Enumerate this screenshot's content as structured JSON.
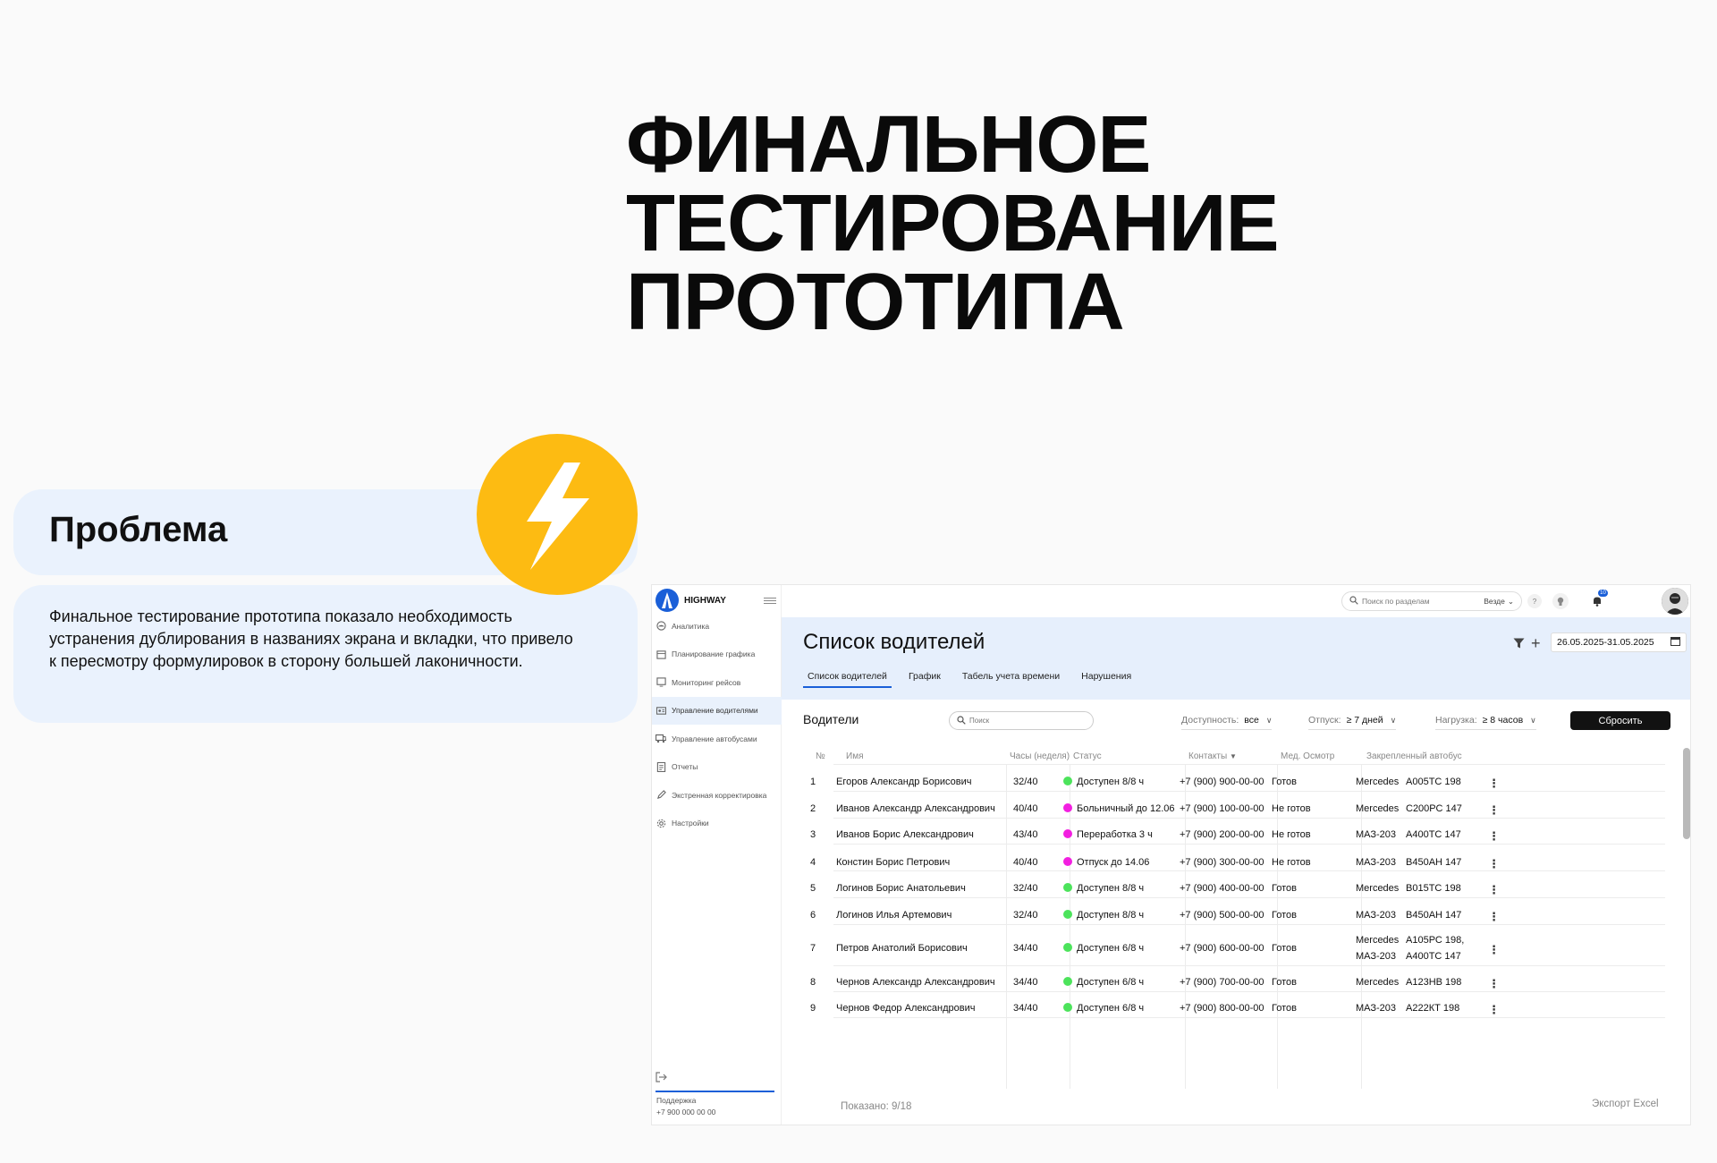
{
  "hero": {
    "lines": [
      "ФИНАЛЬНОЕ",
      "ТЕСТИРОВАНИЕ",
      "ПРОТОТИПА"
    ]
  },
  "problem": {
    "title": "Проблема",
    "lines": [
      "Финальное тестирование прототипа показало необходимость",
      "устранения дублирования в названиях экрана и вкладки, что привело",
      "к пересмотру формулировок в сторону большей лаконичности."
    ],
    "icon": "lightning-bolt-icon",
    "accent": "#FDBB12"
  },
  "app": {
    "brand": "HIGHWAY",
    "nav": [
      {
        "label": "Аналитика",
        "icon": "gauge-icon",
        "active": false
      },
      {
        "label": "Планирование графика",
        "icon": "calendar-icon",
        "active": false
      },
      {
        "label": "Мониторинг рейсов",
        "icon": "monitor-icon",
        "active": false
      },
      {
        "label": "Управление водителями",
        "icon": "id-card-icon",
        "active": true
      },
      {
        "label": "Управление автобусами",
        "icon": "bus-icon",
        "active": false
      },
      {
        "label": "Отчеты",
        "icon": "report-icon",
        "active": false
      },
      {
        "label": "Экстренная корректировка",
        "icon": "pencil-icon",
        "active": false
      },
      {
        "label": "Настройки",
        "icon": "gear-icon",
        "active": false
      }
    ],
    "support": {
      "label": "Поддержка",
      "phone": "+7 900 000 00 00"
    },
    "topbar": {
      "search_placeholder": "Поиск по разделам",
      "search_scope": "Везде",
      "help": "?",
      "notifications": "10"
    },
    "page_title": "Список водителей",
    "date_range": "26.05.2025-31.05.2025",
    "tabs": [
      "Список водителей",
      "График",
      "Табель учета времени",
      "Нарушения"
    ],
    "active_tab": 0,
    "section_title": "Водители",
    "search_placeholder": "Поиск",
    "filters": [
      {
        "key": "Доступность:",
        "value": "все"
      },
      {
        "key": "Отпуск:",
        "value": "≥ 7 дней"
      },
      {
        "key": "Нагрузка:",
        "value": "≥ 8 часов"
      }
    ],
    "reset_label": "Сбросить",
    "columns": [
      "№",
      "Имя",
      "Часы (неделя)",
      "Статус",
      "Контакты",
      "Мед. Осмотр",
      "Закрепленный автобус"
    ],
    "status_colors": {
      "green": "#4CE35B",
      "magenta": "#F21FE0"
    },
    "rows": [
      {
        "n": "1",
        "name": "Егоров Александр Борисович",
        "hours": "32/40",
        "status": "Доступен 8/8 ч",
        "color": "green",
        "phone": "+7 (900) 900-00-00",
        "med": "Готов",
        "bus_model": "Mercedes",
        "bus_plate": "А005ТС 198"
      },
      {
        "n": "2",
        "name": "Иванов Александр Александрович",
        "hours": "40/40",
        "status": "Больничный до 12.06",
        "color": "magenta",
        "phone": "+7 (900) 100-00-00",
        "med": "Не готов",
        "bus_model": "Mercedes",
        "bus_plate": "С200РС 147"
      },
      {
        "n": "3",
        "name": "Иванов Борис Александрович",
        "hours": "43/40",
        "status": "Переработка 3 ч",
        "color": "magenta",
        "phone": "+7 (900) 200-00-00",
        "med": "Не готов",
        "bus_model": "МАЗ-203",
        "bus_plate": "А400ТС 147"
      },
      {
        "n": "4",
        "name": "Констин Борис Петрович",
        "hours": "40/40",
        "status": "Отпуск до 14.06",
        "color": "magenta",
        "phone": "+7 (900) 300-00-00",
        "med": "Не готов",
        "bus_model": "МАЗ-203",
        "bus_plate": "В450АН 147"
      },
      {
        "n": "5",
        "name": "Логинов Борис Анатольевич",
        "hours": "32/40",
        "status": "Доступен 8/8 ч",
        "color": "green",
        "phone": "+7 (900) 400-00-00",
        "med": "Готов",
        "bus_model": "Mercedes",
        "bus_plate": "В015ТС 198"
      },
      {
        "n": "6",
        "name": "Логинов Илья Артемович",
        "hours": "32/40",
        "status": "Доступен 8/8 ч",
        "color": "green",
        "phone": "+7 (900) 500-00-00",
        "med": "Готов",
        "bus_model": "МАЗ-203",
        "bus_plate": "В450АН 147"
      },
      {
        "n": "7",
        "name": "Петров  Анатолий Борисович",
        "hours": "34/40",
        "status": "Доступен 6/8 ч",
        "color": "green",
        "phone": "+7 (900) 600-00-00",
        "med": "Готов",
        "bus_model": "Mercedes",
        "bus_plate": "А105РС 198,",
        "bus_model_2": "МАЗ-203",
        "bus_plate_2": "А400ТС 147"
      },
      {
        "n": "8",
        "name": "Чернов Александр Александрович",
        "hours": "34/40",
        "status": "Доступен 6/8 ч",
        "color": "green",
        "phone": "+7 (900) 700-00-00",
        "med": "Готов",
        "bus_model": "Mercedes",
        "bus_plate": "А123НВ 198"
      },
      {
        "n": "9",
        "name": "Чернов Федор Александрович",
        "hours": "34/40",
        "status": "Доступен 6/8 ч",
        "color": "green",
        "phone": "+7 (900) 800-00-00",
        "med": "Готов",
        "bus_model": "МАЗ-203",
        "bus_plate": "А222КТ 198"
      }
    ],
    "shown": "Показано: 9/18",
    "export": "Экспорт Excel"
  }
}
